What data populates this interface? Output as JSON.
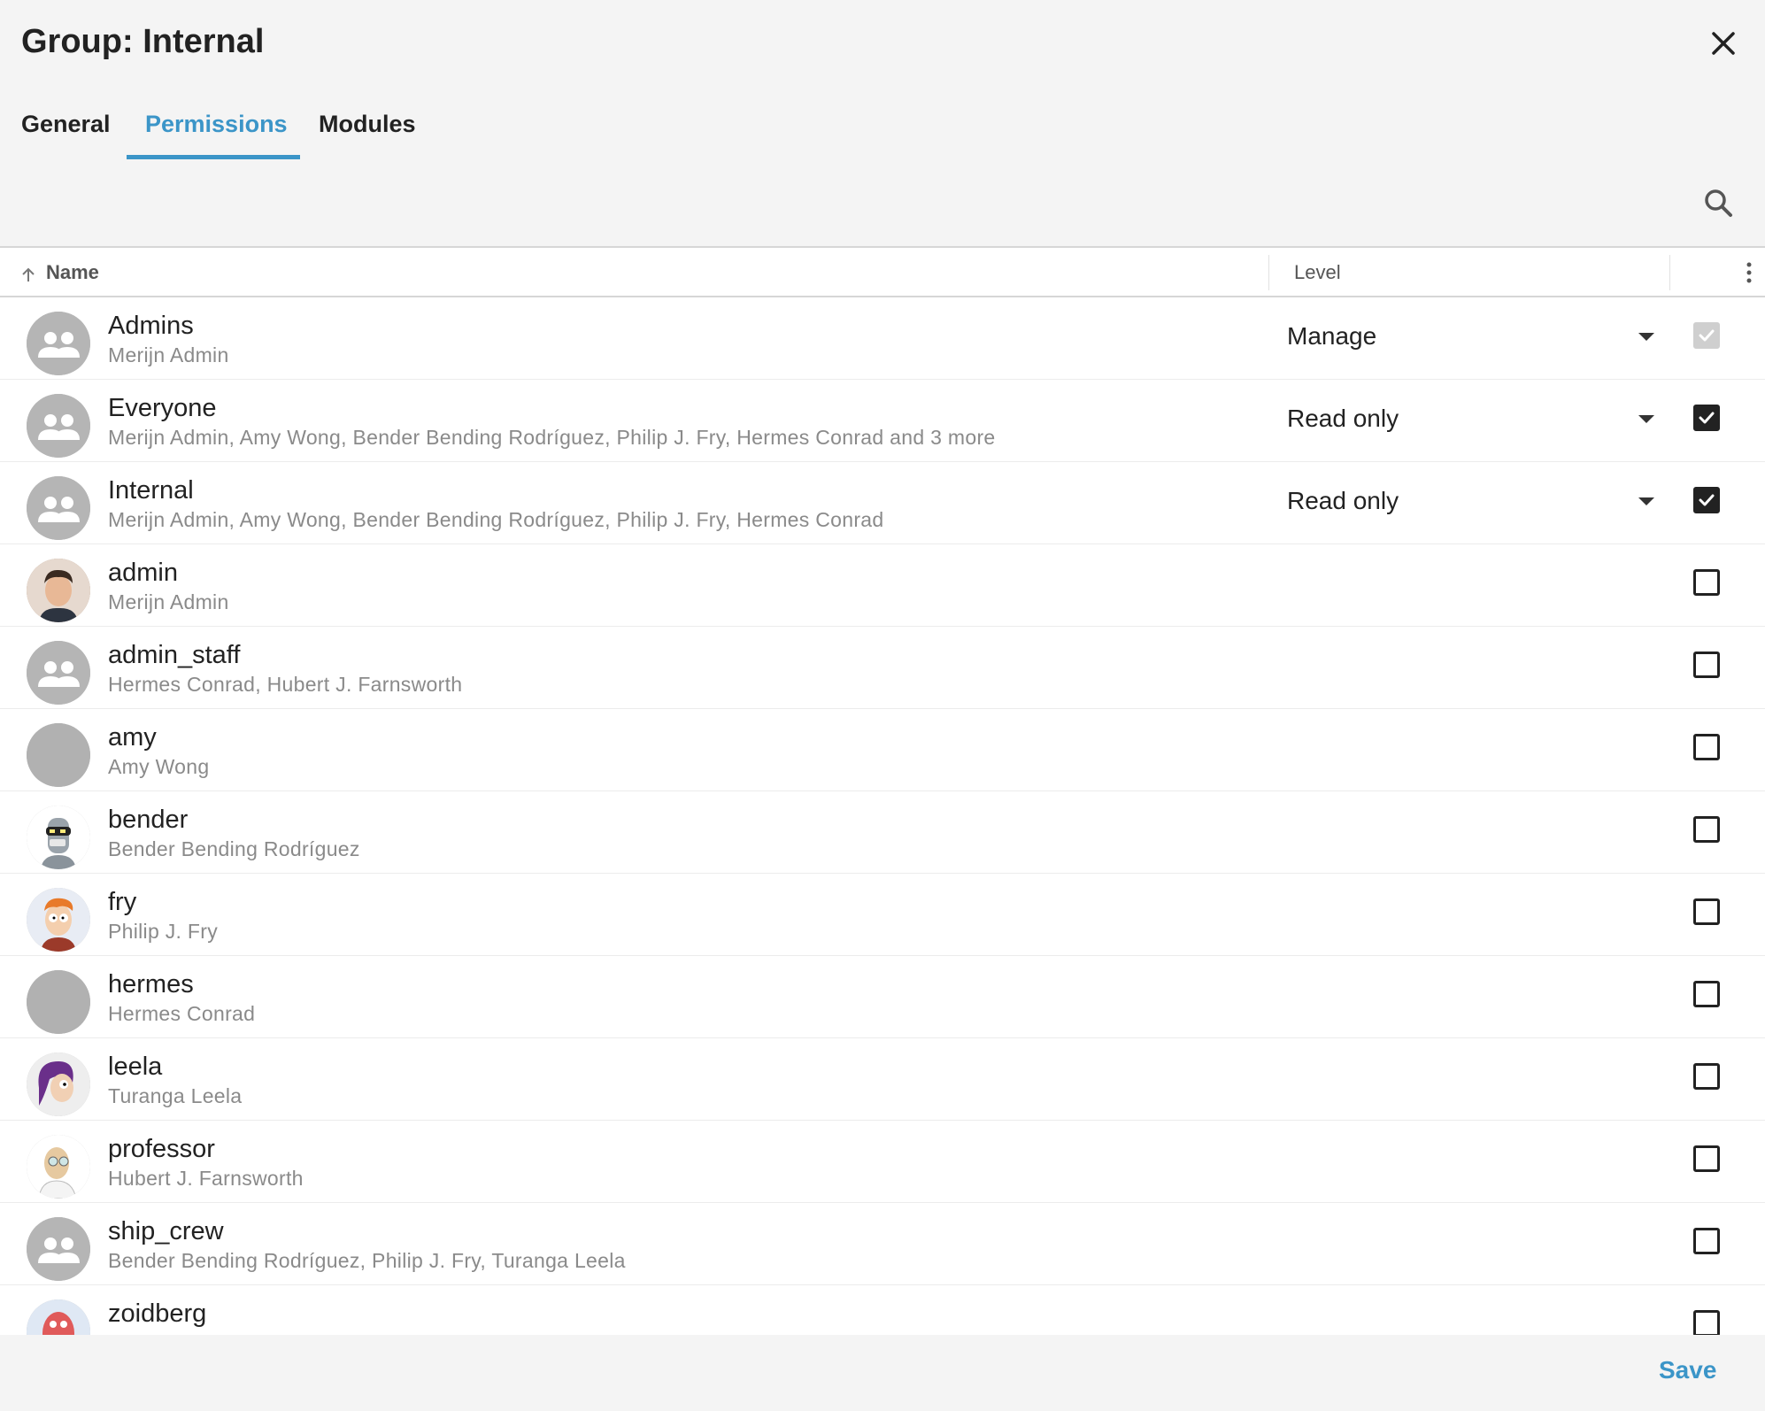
{
  "dialog": {
    "title": "Group: Internal"
  },
  "tabs": [
    {
      "label": "General",
      "active": false
    },
    {
      "label": "Permissions",
      "active": true
    },
    {
      "label": "Modules",
      "active": false
    }
  ],
  "grid": {
    "columns": {
      "name": "Name",
      "level": "Level"
    },
    "rows": [
      {
        "name": "Admins",
        "members": "Merijn Admin",
        "level": "Manage",
        "checked": true,
        "disabled": true,
        "avatar": "group-avatar-icon"
      },
      {
        "name": "Everyone",
        "members": "Merijn Admin, Amy Wong, Bender Bending Rodríguez, Philip J. Fry, Hermes Conrad and 3 more",
        "level": "Read only",
        "checked": true,
        "avatar": "group-avatar-icon"
      },
      {
        "name": "Internal",
        "members": "Merijn Admin, Amy Wong, Bender Bending Rodríguez, Philip J. Fry, Hermes Conrad",
        "level": "Read only",
        "checked": true,
        "avatar": "group-avatar-icon"
      },
      {
        "name": "admin",
        "members": "Merijn Admin",
        "level": "",
        "checked": false,
        "avatar": "user-photo-admin"
      },
      {
        "name": "admin_staff",
        "members": "Hermes Conrad, Hubert J. Farnsworth",
        "level": "",
        "checked": false,
        "avatar": "group-avatar-icon"
      },
      {
        "name": "amy",
        "members": "Amy Wong",
        "level": "",
        "checked": false,
        "avatar": "blank-avatar"
      },
      {
        "name": "bender",
        "members": "Bender Bending Rodríguez",
        "level": "",
        "checked": false,
        "avatar": "user-photo-bender"
      },
      {
        "name": "fry",
        "members": "Philip J. Fry",
        "level": "",
        "checked": false,
        "avatar": "user-photo-fry"
      },
      {
        "name": "hermes",
        "members": "Hermes Conrad",
        "level": "",
        "checked": false,
        "avatar": "blank-avatar"
      },
      {
        "name": "leela",
        "members": "Turanga Leela",
        "level": "",
        "checked": false,
        "avatar": "user-photo-leela"
      },
      {
        "name": "professor",
        "members": "Hubert J. Farnsworth",
        "level": "",
        "checked": false,
        "avatar": "user-photo-professor"
      },
      {
        "name": "ship_crew",
        "members": "Bender Bending Rodríguez, Philip J. Fry, Turanga Leela",
        "level": "",
        "checked": false,
        "avatar": "group-avatar-icon"
      },
      {
        "name": "zoidberg",
        "members": "",
        "level": "",
        "checked": false,
        "avatar": "user-photo-zoidberg"
      }
    ]
  },
  "footer": {
    "save_label": "Save"
  },
  "icons": {
    "close": "close-icon",
    "search": "search-icon",
    "sort": "sort-ascending-icon",
    "column_menu": "more-vertical-icon",
    "dropdown": "caret-down-icon",
    "check": "checkmark-icon"
  },
  "colors": {
    "accent": "#3b95c8",
    "background": "#f4f4f4",
    "text": "#222222",
    "subtext": "#8a8a8a",
    "checkbox": "#222222",
    "checkbox_disabled": "#cfcfcf"
  }
}
